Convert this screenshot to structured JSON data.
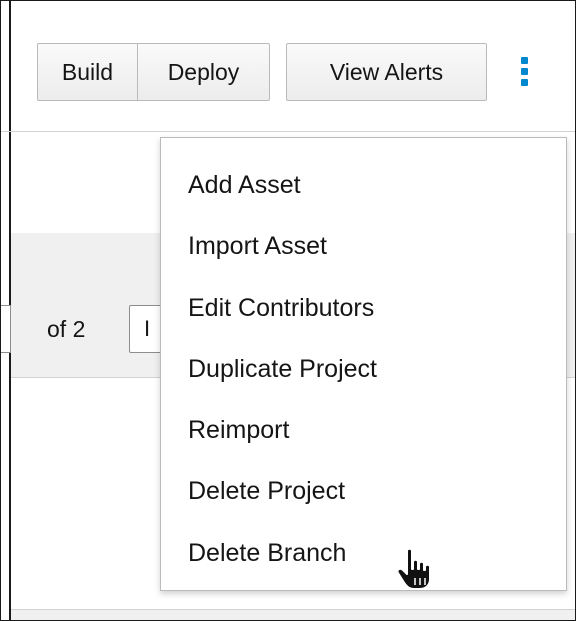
{
  "toolbar": {
    "build_label": "Build",
    "deploy_label": "Deploy",
    "view_alerts_label": "View Alerts",
    "kebab_icon": "kebab-vertical-icon",
    "accent_color": "#0088ce"
  },
  "pagination": {
    "of_label": "of 2",
    "next_label": "I"
  },
  "menu": {
    "items": [
      {
        "label": "Add Asset"
      },
      {
        "label": "Import Asset"
      },
      {
        "label": "Edit Contributors"
      },
      {
        "label": "Duplicate Project"
      },
      {
        "label": "Reimport"
      },
      {
        "label": "Delete Project"
      },
      {
        "label": "Delete Branch"
      }
    ]
  },
  "cursor": {
    "icon": "hand-pointer-icon"
  }
}
